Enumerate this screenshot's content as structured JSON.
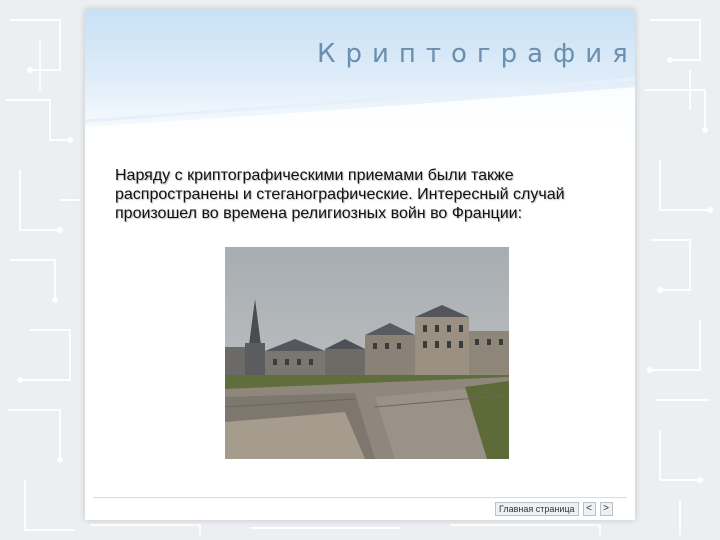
{
  "slide": {
    "title": "Криптография",
    "body": "Наряду с криптографическими приемами были также распространены и стеганографические. Интересный случай произошел во времена религиозных войн во Франции:"
  },
  "photo": {
    "subject": "old-town-rampart-photo"
  },
  "nav": {
    "home_label": "Главная страница",
    "prev_label": "<",
    "next_label": ">"
  },
  "colors": {
    "title": "#6b8fae",
    "header": "#c9e0f5",
    "background": "#e9ecef"
  }
}
